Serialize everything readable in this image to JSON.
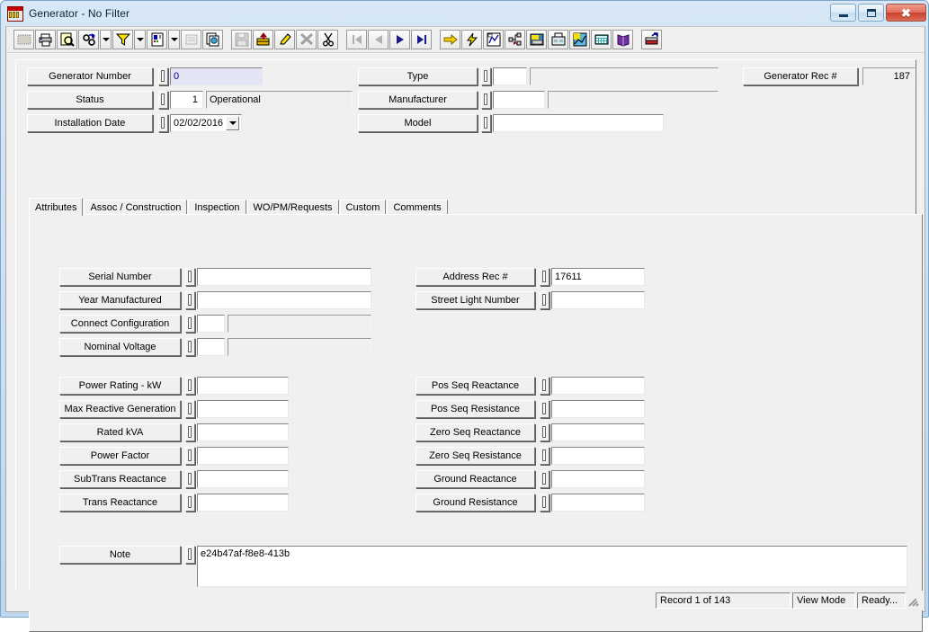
{
  "window": {
    "title": "Generator - No Filter",
    "app_icon": "generator-app-icon",
    "buttons": {
      "minimize": "minimize-button",
      "maximize": "maximize-button",
      "close": "close-button"
    }
  },
  "toolbar": {
    "items": [
      {
        "name": "select-tool-icon",
        "type": "button",
        "enabled": false
      },
      {
        "name": "print-icon",
        "type": "button",
        "enabled": true
      },
      {
        "name": "print-preview-icon",
        "type": "button",
        "enabled": true
      },
      {
        "name": "find-icon",
        "type": "button",
        "enabled": true
      },
      {
        "name": "find-dropdown-icon",
        "type": "dropdown",
        "enabled": true
      },
      {
        "name": "filter-icon",
        "type": "button",
        "enabled": true
      },
      {
        "name": "filter-dropdown-icon",
        "type": "dropdown",
        "enabled": true
      },
      {
        "name": "report-icon",
        "type": "button",
        "enabled": true
      },
      {
        "name": "report-dropdown-icon",
        "type": "dropdown",
        "enabled": true
      },
      {
        "name": "form-design-icon",
        "type": "button",
        "enabled": false
      },
      {
        "name": "copy-record-icon",
        "type": "button",
        "enabled": true
      },
      {
        "name": "save-icon",
        "type": "button",
        "enabled": false
      },
      {
        "name": "new-record-icon",
        "type": "button",
        "enabled": true
      },
      {
        "name": "edit-record-icon",
        "type": "button",
        "enabled": true
      },
      {
        "name": "delete-record-icon",
        "type": "button",
        "enabled": false
      },
      {
        "name": "cut-icon",
        "type": "button",
        "enabled": true
      },
      {
        "name": "first-record-icon",
        "type": "button",
        "enabled": false
      },
      {
        "name": "previous-record-icon",
        "type": "button",
        "enabled": false
      },
      {
        "name": "next-record-icon",
        "type": "button",
        "enabled": true
      },
      {
        "name": "last-record-icon",
        "type": "button",
        "enabled": true
      },
      {
        "name": "goto-icon",
        "type": "button",
        "enabled": true
      },
      {
        "name": "quick-action-icon",
        "type": "button",
        "enabled": true
      },
      {
        "name": "map-icon",
        "type": "button",
        "enabled": true
      },
      {
        "name": "hierarchy-icon",
        "type": "button",
        "enabled": true
      },
      {
        "name": "attachment-icon",
        "type": "button",
        "enabled": true
      },
      {
        "name": "fax-icon",
        "type": "button",
        "enabled": true
      },
      {
        "name": "chart-icon",
        "type": "button",
        "enabled": true
      },
      {
        "name": "calculator-icon",
        "type": "button",
        "enabled": true
      },
      {
        "name": "help-book-icon",
        "type": "button",
        "enabled": true
      },
      {
        "name": "exit-icon",
        "type": "button",
        "enabled": true
      }
    ]
  },
  "header": {
    "left_fields": [
      {
        "label": "Generator Number",
        "value": "0",
        "style": "focused",
        "kind": "single"
      },
      {
        "label": "Status",
        "code": "1",
        "desc": "Operational",
        "kind": "code-desc"
      },
      {
        "label": "Installation Date",
        "value": "02/02/2016",
        "kind": "date"
      }
    ],
    "mid_fields": [
      {
        "label": "Type",
        "code": "",
        "desc": "",
        "kind": "code-desc"
      },
      {
        "label": "Manufacturer",
        "code": "",
        "desc": "",
        "kind": "code-desc"
      },
      {
        "label": "Model",
        "value": "",
        "kind": "single"
      }
    ],
    "rec": {
      "label": "Generator Rec #",
      "value": "187"
    }
  },
  "tabs": [
    {
      "label": "Attributes",
      "active": true
    },
    {
      "label": "Assoc / Construction",
      "active": false
    },
    {
      "label": "Inspection",
      "active": false
    },
    {
      "label": "WO/PM/Requests",
      "active": false
    },
    {
      "label": "Custom",
      "active": false
    },
    {
      "label": "Comments",
      "active": false
    }
  ],
  "attributes": {
    "left_group_1": [
      {
        "label": "Serial Number",
        "value": "",
        "kind": "single"
      },
      {
        "label": "Year Manufactured",
        "value": "",
        "kind": "single"
      },
      {
        "label": "Connect Configuration",
        "code": "",
        "desc": "",
        "kind": "code-desc"
      },
      {
        "label": "Nominal Voltage",
        "code": "",
        "desc": "",
        "kind": "code-desc"
      }
    ],
    "left_group_2": [
      {
        "label": "Power Rating - kW",
        "value": "",
        "kind": "single"
      },
      {
        "label": "Max Reactive Generation",
        "value": "",
        "kind": "single"
      },
      {
        "label": "Rated kVA",
        "value": "",
        "kind": "single"
      },
      {
        "label": "Power Factor",
        "value": "",
        "kind": "single"
      },
      {
        "label": "SubTrans Reactance",
        "value": "",
        "kind": "single"
      },
      {
        "label": "Trans Reactance",
        "value": "",
        "kind": "single"
      }
    ],
    "right_group_1": [
      {
        "label": "Address Rec #",
        "value": "17611",
        "kind": "single"
      },
      {
        "label": "Street Light Number",
        "value": "",
        "kind": "single"
      }
    ],
    "right_group_2": [
      {
        "label": "Pos Seq Reactance",
        "value": "",
        "kind": "single"
      },
      {
        "label": "Pos Seq Resistance",
        "value": "",
        "kind": "single"
      },
      {
        "label": "Zero Seq Reactance",
        "value": "",
        "kind": "single"
      },
      {
        "label": "Zero Seq Resistance",
        "value": "",
        "kind": "single"
      },
      {
        "label": "Ground Reactance",
        "value": "",
        "kind": "single"
      },
      {
        "label": "Ground Resistance",
        "value": "",
        "kind": "single"
      }
    ],
    "note": {
      "label": "Note",
      "value": "e24b47af-f8e8-413b"
    }
  },
  "statusbar": {
    "record": "Record 1 of 143",
    "mode": "View Mode",
    "ready": "Ready...",
    "grip": "resize-grip"
  },
  "colors": {
    "face": "#f0f0f0",
    "focus_field_bg": "#e4e4f7",
    "focus_field_text": "#000080",
    "titlebar_from": "#d7e7f5",
    "titlebar_to": "#bcd7ee",
    "close_button": "#c9402c",
    "nav_arrow": "#1a1a8c"
  }
}
